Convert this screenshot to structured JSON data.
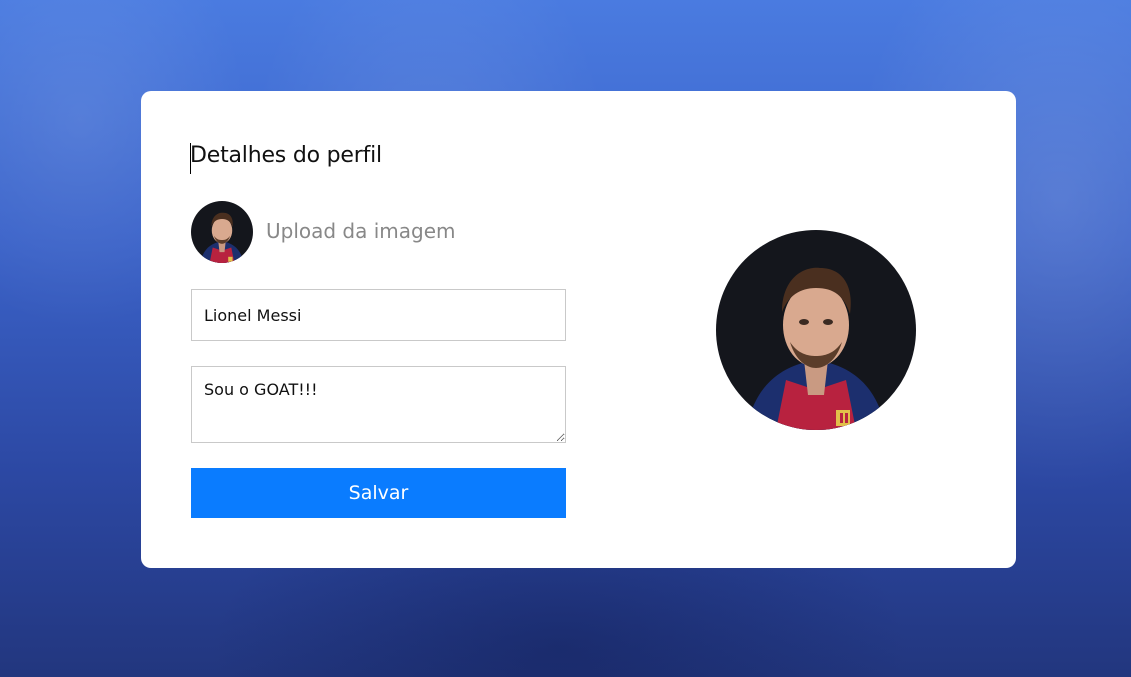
{
  "profile": {
    "title": "Detalhes do perfil",
    "upload_label": "Upload da imagem",
    "name_value": "Lionel Messi",
    "bio_value": "Sou o GOAT!!!",
    "save_label": "Salvar"
  },
  "colors": {
    "accent": "#0a7cff",
    "card": "#ffffff",
    "background": "#3b63c9"
  }
}
